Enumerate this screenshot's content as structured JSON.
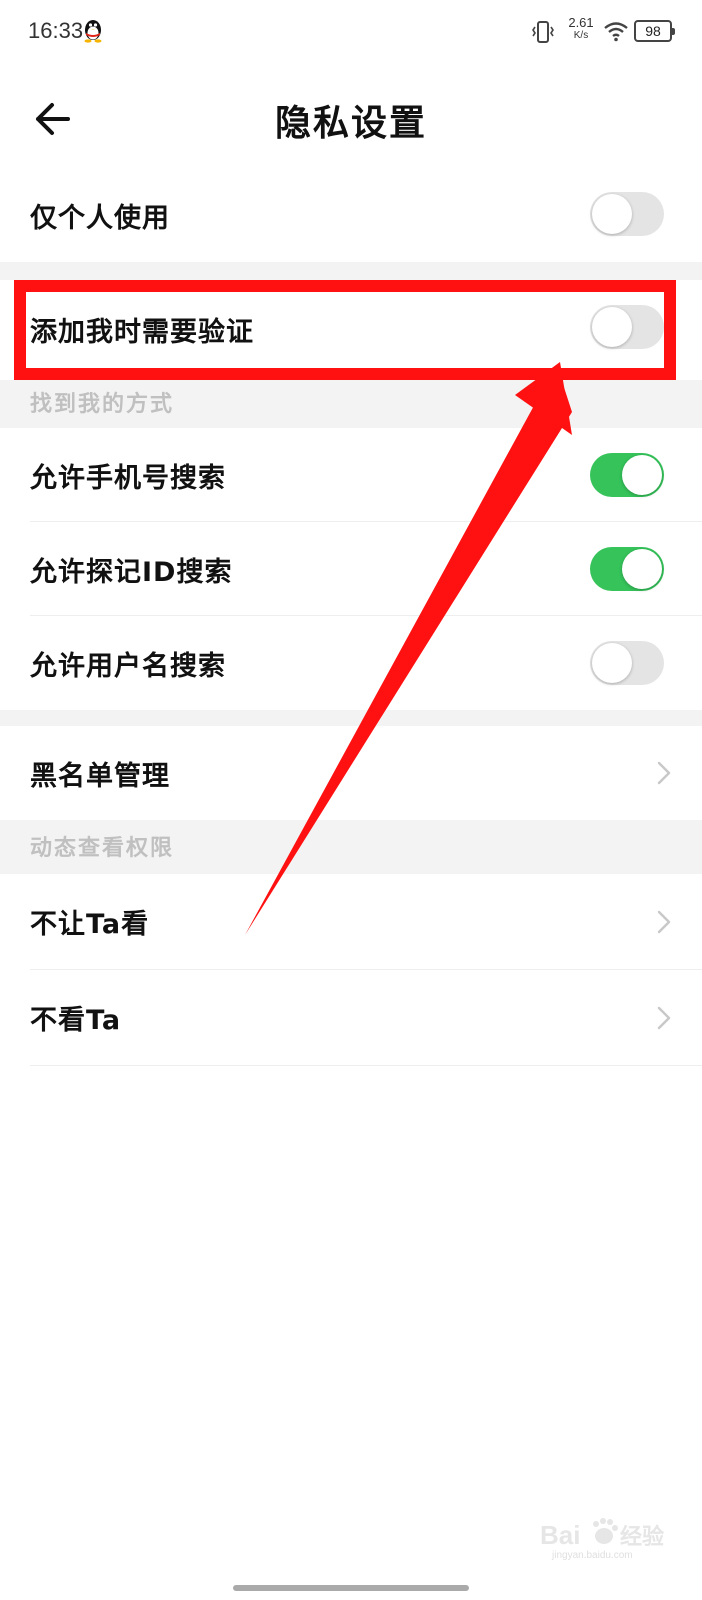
{
  "status_bar": {
    "time": "16:33",
    "net_speed_value": "2.61",
    "net_speed_unit": "K/s",
    "battery": "98"
  },
  "header": {
    "title": "隐私设置",
    "back_icon": "arrow-left-icon"
  },
  "settings": {
    "personal_use": {
      "label": "仅个人使用",
      "enabled": false
    },
    "verify_on_add": {
      "label": "添加我时需要验证",
      "enabled": false
    },
    "find_me_section": "找到我的方式",
    "find_me_items": [
      {
        "label": "允许手机号搜索",
        "enabled": true
      },
      {
        "label": "允许探记ID搜索",
        "enabled": true
      },
      {
        "label": "允许用户名搜索",
        "enabled": false
      }
    ],
    "blacklist": {
      "label": "黑名单管理"
    },
    "feed_section": "动态查看权限",
    "feed_items": [
      {
        "label": "不让Ta看"
      },
      {
        "label": "不看Ta"
      }
    ]
  },
  "colors": {
    "toggle_on": "#35c35a",
    "toggle_off": "#e4e4e4",
    "annotation": "#ff1111",
    "section_bg": "#f3f3f3"
  },
  "watermark": {
    "brand": "Bai",
    "brand_suffix": "经验",
    "url": "jingyan.baidu.com"
  }
}
